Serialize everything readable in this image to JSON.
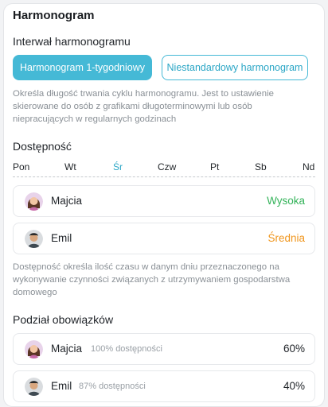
{
  "card_title": "Harmonogram",
  "schedule_interval": {
    "title": "Interwał harmonogramu",
    "options": [
      "Harmonogram 1-tygodniowy",
      "Niestandardowy harmonogram"
    ],
    "selected": "Harmonogram 1-tygodniowy",
    "hint": "Określa długość trwania cyklu harmonogramu. Jest to ustawienie skierowane do osób z grafikami długoterminowymi lub osób niepracujących w regularnych godzinach"
  },
  "availability": {
    "title": "Dostępność",
    "days": [
      "Pon",
      "Wt",
      "Śr",
      "Czw",
      "Pt",
      "Sb",
      "Nd"
    ],
    "selected_day": "Śr",
    "people": [
      {
        "name": "Majcia",
        "level": "Wysoka",
        "level_color": "#34b35a",
        "avatar": "female-avatar-icon"
      },
      {
        "name": "Emil",
        "level": "Średnia",
        "level_color": "#f0961e",
        "avatar": "male-avatar-icon"
      }
    ],
    "hint": "Dostępność określa ilość czasu w danym dniu przeznaczonego na wykonywanie czynności związanych z utrzymywaniem gospodarstwa domowego"
  },
  "duties": {
    "title": "Podział obowiązków",
    "people": [
      {
        "name": "Majcia",
        "availability": "100% dostępności",
        "share": "60%"
      },
      {
        "name": "Emil",
        "availability": "87% dostępności",
        "share": "40%"
      }
    ]
  },
  "colors": {
    "accent": "#45b9d6",
    "high": "#34b35a",
    "medium": "#f0961e"
  }
}
